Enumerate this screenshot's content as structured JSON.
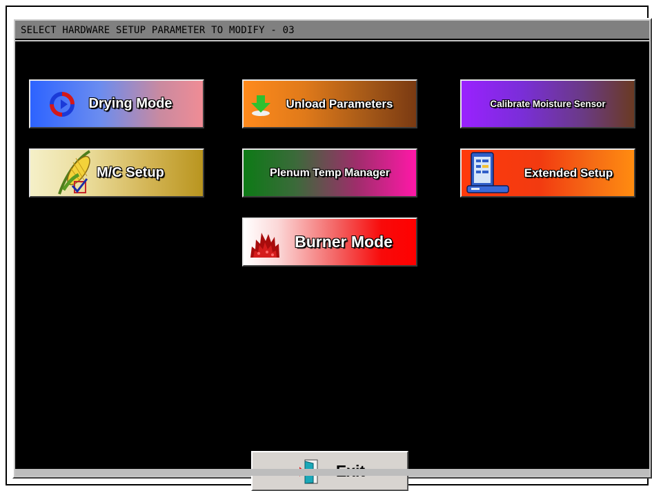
{
  "window": {
    "title": "SELECT HARDWARE SETUP PARAMETER TO MODIFY - 03"
  },
  "buttons": {
    "drying_mode": {
      "label": "Drying Mode",
      "icon": "refresh-cycle-icon"
    },
    "unload_parameters": {
      "label": "Unload Parameters",
      "icon": "download-arrow-icon"
    },
    "calibrate_moisture_sensor": {
      "label": "Calibrate Moisture Sensor"
    },
    "mc_setup": {
      "label": "M/C Setup",
      "icon": "corn-checkmark-icon"
    },
    "plenum_temp_manager": {
      "label": "Plenum Temp Manager"
    },
    "extended_setup": {
      "label": "Extended Setup",
      "icon": "control-panel-icon"
    },
    "burner_mode": {
      "label": "Burner Mode",
      "icon": "fire-icon"
    },
    "exit": {
      "label": "Exit",
      "icon": "exit-door-icon"
    }
  },
  "colors": {
    "panel_background": "#000000",
    "title_bar": "#808080",
    "exit_button": "#d8d4d0"
  }
}
